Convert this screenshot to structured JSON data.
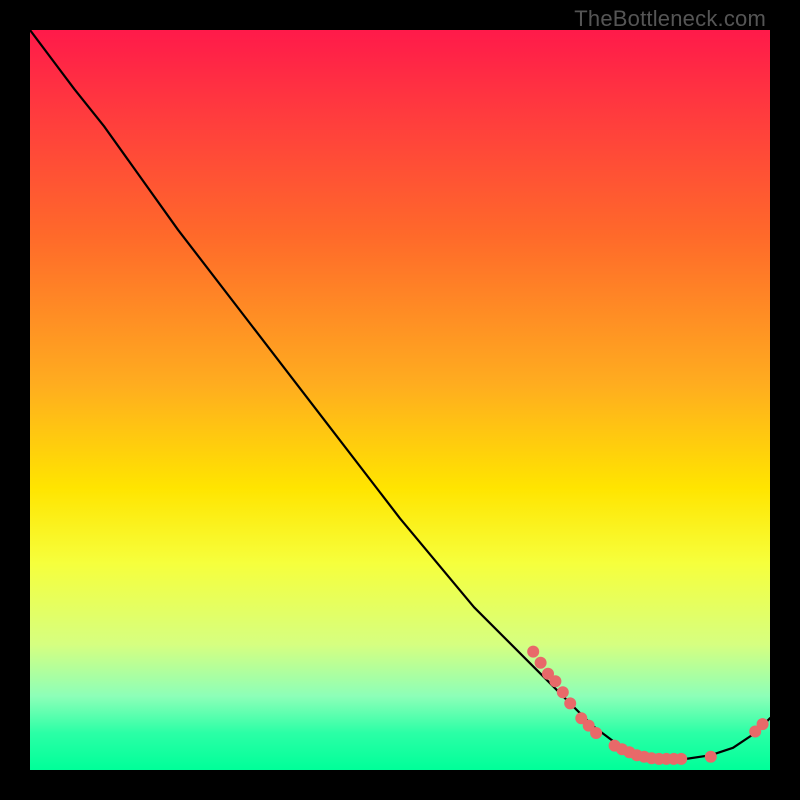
{
  "watermark": "TheBottleneck.com",
  "chart_data": {
    "type": "line",
    "title": "",
    "xlabel": "",
    "ylabel": "",
    "xlim": [
      0,
      100
    ],
    "ylim": [
      0,
      100
    ],
    "grid": false,
    "legend": false,
    "series": [
      {
        "name": "curve",
        "type": "line",
        "color": "#000000",
        "points": [
          {
            "x": 0,
            "y": 100
          },
          {
            "x": 3,
            "y": 96
          },
          {
            "x": 6,
            "y": 92
          },
          {
            "x": 10,
            "y": 87
          },
          {
            "x": 15,
            "y": 80
          },
          {
            "x": 20,
            "y": 73
          },
          {
            "x": 30,
            "y": 60
          },
          {
            "x": 40,
            "y": 47
          },
          {
            "x": 50,
            "y": 34
          },
          {
            "x": 60,
            "y": 22
          },
          {
            "x": 70,
            "y": 12
          },
          {
            "x": 76,
            "y": 6
          },
          {
            "x": 80,
            "y": 3
          },
          {
            "x": 84,
            "y": 1.5
          },
          {
            "x": 88,
            "y": 1.4
          },
          {
            "x": 92,
            "y": 2
          },
          {
            "x": 95,
            "y": 3
          },
          {
            "x": 98,
            "y": 5
          },
          {
            "x": 100,
            "y": 7
          }
        ]
      },
      {
        "name": "dots",
        "type": "scatter",
        "color": "#e86969",
        "radius": 6,
        "points": [
          {
            "x": 68,
            "y": 16
          },
          {
            "x": 69,
            "y": 14.5
          },
          {
            "x": 70,
            "y": 13
          },
          {
            "x": 71,
            "y": 12
          },
          {
            "x": 72,
            "y": 10.5
          },
          {
            "x": 73,
            "y": 9
          },
          {
            "x": 74.5,
            "y": 7
          },
          {
            "x": 75.5,
            "y": 6
          },
          {
            "x": 76.5,
            "y": 5
          },
          {
            "x": 79,
            "y": 3.3
          },
          {
            "x": 80,
            "y": 2.8
          },
          {
            "x": 81,
            "y": 2.4
          },
          {
            "x": 82,
            "y": 2.0
          },
          {
            "x": 83,
            "y": 1.8
          },
          {
            "x": 84,
            "y": 1.6
          },
          {
            "x": 85,
            "y": 1.5
          },
          {
            "x": 86,
            "y": 1.5
          },
          {
            "x": 87,
            "y": 1.5
          },
          {
            "x": 88,
            "y": 1.5
          },
          {
            "x": 92,
            "y": 1.8
          },
          {
            "x": 98,
            "y": 5.2
          },
          {
            "x": 99,
            "y": 6.2
          }
        ]
      }
    ]
  }
}
